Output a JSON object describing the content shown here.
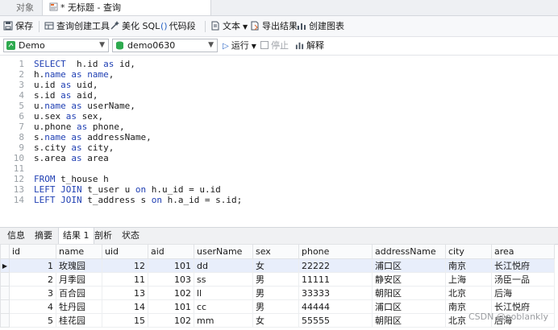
{
  "tabs": {
    "objects_label": "对象",
    "active_label": "* 无标题 - 查询"
  },
  "toolbar": {
    "save": "保存",
    "query_builder": "查询创建工具",
    "beautify": "美化 SQL",
    "snippet": "代码段",
    "text": "文本",
    "export": "导出结果",
    "create_chart": "创建图表"
  },
  "connection": {
    "server": "Demo",
    "database": "demo0630",
    "run": "运行",
    "stop": "停止",
    "explain": "解释"
  },
  "editor": {
    "lines": [
      {
        "n": "1",
        "parts": [
          [
            "kw",
            "SELECT"
          ],
          [
            "",
            "  h.id "
          ],
          [
            "kw",
            "as"
          ],
          [
            "",
            " id,"
          ]
        ]
      },
      {
        "n": "2",
        "parts": [
          [
            "",
            "h."
          ],
          [
            "kw",
            "name"
          ],
          [
            "",
            " "
          ],
          [
            "kw",
            "as"
          ],
          [
            "",
            " "
          ],
          [
            "kw",
            "name"
          ],
          [
            "",
            ","
          ]
        ]
      },
      {
        "n": "3",
        "parts": [
          [
            "",
            "u.id "
          ],
          [
            "kw",
            "as"
          ],
          [
            "",
            " uid,"
          ]
        ]
      },
      {
        "n": "4",
        "parts": [
          [
            "",
            "s.id "
          ],
          [
            "kw",
            "as"
          ],
          [
            "",
            " aid,"
          ]
        ]
      },
      {
        "n": "5",
        "parts": [
          [
            "",
            "u."
          ],
          [
            "kw",
            "name"
          ],
          [
            "",
            " "
          ],
          [
            "kw",
            "as"
          ],
          [
            "",
            " userName,"
          ]
        ]
      },
      {
        "n": "6",
        "parts": [
          [
            "",
            "u.sex "
          ],
          [
            "kw",
            "as"
          ],
          [
            "",
            " sex,"
          ]
        ]
      },
      {
        "n": "7",
        "parts": [
          [
            "",
            "u.phone "
          ],
          [
            "kw",
            "as"
          ],
          [
            "",
            " phone,"
          ]
        ]
      },
      {
        "n": "8",
        "parts": [
          [
            "",
            "s."
          ],
          [
            "kw",
            "name"
          ],
          [
            "",
            " "
          ],
          [
            "kw",
            "as"
          ],
          [
            "",
            " addressName,"
          ]
        ]
      },
      {
        "n": "9",
        "parts": [
          [
            "",
            "s.city "
          ],
          [
            "kw",
            "as"
          ],
          [
            "",
            " city,"
          ]
        ]
      },
      {
        "n": "10",
        "parts": [
          [
            "",
            "s.area "
          ],
          [
            "kw",
            "as"
          ],
          [
            "",
            " area"
          ]
        ]
      },
      {
        "n": "11",
        "parts": []
      },
      {
        "n": "12",
        "parts": [
          [
            "kw",
            "FROM"
          ],
          [
            "",
            " t_house h"
          ]
        ]
      },
      {
        "n": "13",
        "parts": [
          [
            "kw",
            "LEFT JOIN"
          ],
          [
            "",
            " t_user u "
          ],
          [
            "kw",
            "on"
          ],
          [
            "",
            " h.u_id = u.id"
          ]
        ]
      },
      {
        "n": "14",
        "parts": [
          [
            "kw",
            "LEFT JOIN"
          ],
          [
            "",
            " t_address s "
          ],
          [
            "kw",
            "on"
          ],
          [
            "",
            " h.a_id = s.id;"
          ]
        ]
      }
    ]
  },
  "result_tabs": [
    "信息",
    "摘要",
    "结果 1",
    "剖析",
    "状态"
  ],
  "result": {
    "columns": [
      "id",
      "name",
      "uid",
      "aid",
      "userName",
      "sex",
      "phone",
      "addressName",
      "city",
      "area"
    ],
    "rows": [
      [
        "1",
        "玫瑰园",
        "12",
        "101",
        "dd",
        "女",
        "22222",
        "浦口区",
        "南京",
        "长江悦府"
      ],
      [
        "2",
        "月季园",
        "11",
        "103",
        "ss",
        "男",
        "11111",
        "静安区",
        "上海",
        "汤臣一品"
      ],
      [
        "3",
        "百合园",
        "13",
        "102",
        "ll",
        "男",
        "33333",
        "朝阳区",
        "北京",
        "后海"
      ],
      [
        "4",
        "牡丹园",
        "14",
        "101",
        "cc",
        "男",
        "44444",
        "浦口区",
        "南京",
        "长江悦府"
      ],
      [
        "5",
        "桂花园",
        "15",
        "102",
        "mm",
        "女",
        "55555",
        "朝阳区",
        "北京",
        "后海"
      ]
    ]
  },
  "watermark": "CSDN @ooblankly",
  "colors": {
    "keyword": "#1f3fb3",
    "selected_row": "#e8eefb"
  }
}
